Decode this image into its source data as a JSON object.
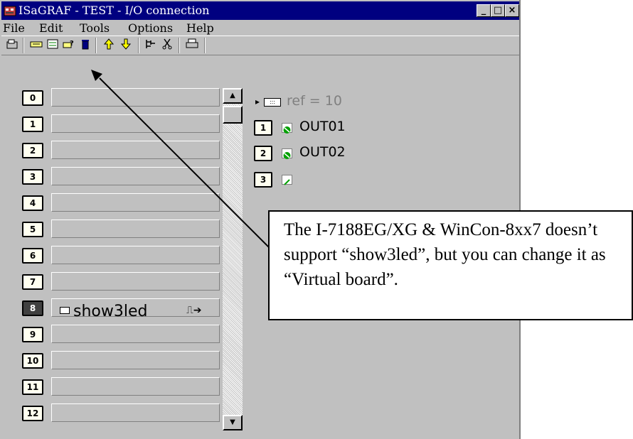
{
  "window": {
    "title": "ISaGRAF - TEST - I/O connection",
    "controls": {
      "minimize": "_",
      "maximize": "□",
      "close": "×"
    }
  },
  "menu": [
    "File",
    "Edit",
    "Tools",
    "Options",
    "Help"
  ],
  "toolbar": {
    "icons": [
      "open-icon",
      "board-icon",
      "configure-board-icon",
      "board-params-icon",
      "delete-icon",
      "move-up-icon",
      "move-down-icon",
      "connect-icon",
      "cut-icon",
      "print-icon"
    ],
    "colors": {
      "arrows": "#ffff00",
      "delete": "#000080"
    }
  },
  "slots": [
    {
      "number": "0",
      "board": ""
    },
    {
      "number": "1",
      "board": ""
    },
    {
      "number": "2",
      "board": ""
    },
    {
      "number": "3",
      "board": ""
    },
    {
      "number": "4",
      "board": ""
    },
    {
      "number": "5",
      "board": ""
    },
    {
      "number": "6",
      "board": ""
    },
    {
      "number": "7",
      "board": ""
    },
    {
      "number": "8",
      "board": "show3led",
      "selected": true
    },
    {
      "number": "9",
      "board": ""
    },
    {
      "number": "10",
      "board": ""
    },
    {
      "number": "11",
      "board": ""
    },
    {
      "number": "12",
      "board": ""
    }
  ],
  "board_detail": {
    "ref": "ref = 10",
    "channels": [
      {
        "number": "1",
        "variable": "OUT01",
        "icon": "output-variable-icon"
      },
      {
        "number": "2",
        "variable": "OUT02",
        "icon": "output-variable-icon"
      },
      {
        "number": "3",
        "variable": "",
        "icon": "empty-variable-icon"
      }
    ]
  },
  "callout": {
    "text": "The I-7188EG/XG & WinCon-8xx7 doesn’t support “show3led”, but you can change it as “Virtual board”."
  },
  "colors": {
    "titlebar": "#000080",
    "window": "#c0c0c0",
    "slot_bg": "#fffff0",
    "selected_slot": "#404040",
    "variable_icon": "#00a000",
    "ref_text": "#808080"
  }
}
